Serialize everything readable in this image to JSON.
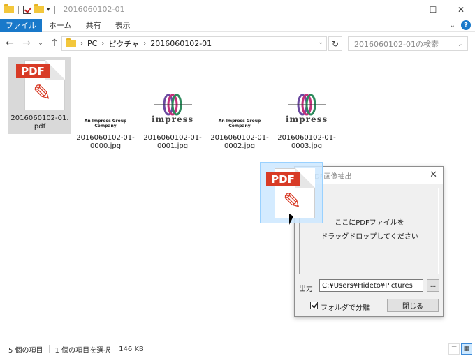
{
  "window": {
    "title": "2016060102-01",
    "min_glyph": "—",
    "max_glyph": "☐",
    "close_glyph": "✕"
  },
  "ribbon": {
    "tabs": [
      "ファイル",
      "ホーム",
      "共有",
      "表示"
    ],
    "collapse_glyph": "⌄",
    "help_glyph": "?"
  },
  "nav": {
    "back_glyph": "←",
    "forward_glyph": "→",
    "recent_glyph": "⌄",
    "up_glyph": "↑",
    "breadcrumb": [
      "PC",
      "ピクチャ",
      "2016060102-01"
    ],
    "crumb_sep": "›",
    "dropdown_glyph": "⌄",
    "refresh_glyph": "↻",
    "search_placeholder": "2016060102-01の検索",
    "search_glyph": "⌕"
  },
  "files": [
    {
      "name": "2016060102-01.pdf",
      "kind": "pdf",
      "badge": "PDF",
      "glyph": "✎"
    },
    {
      "name": "2016060102-01-0000.jpg",
      "kind": "impress-small",
      "logo": "An Impress Group Company"
    },
    {
      "name": "2016060102-01-0001.jpg",
      "kind": "impress-big",
      "logo": "impress"
    },
    {
      "name": "2016060102-01-0002.jpg",
      "kind": "impress-small",
      "logo": "An Impress Group Company"
    },
    {
      "name": "2016060102-01-0003.jpg",
      "kind": "impress-big",
      "logo": "impress"
    }
  ],
  "dialog": {
    "title": "PDF画像抽出",
    "close_glyph": "✕",
    "drop_line1": "ここにPDFファイルを",
    "drop_line2": "ドラッグドロップしてください",
    "output_label": "出力",
    "output_value": "C:¥Users¥Hideto¥Pictures",
    "browse_label": "...",
    "checkbox_label": "フォルダで分離",
    "checkbox_checked": true,
    "close_label": "閉じる"
  },
  "drag_ghost": {
    "badge": "PDF",
    "glyph": "✎"
  },
  "status": {
    "item_count": "5 個の項目",
    "selection": "1 個の項目を選択",
    "size": "146 KB",
    "details_view_glyph": "☰",
    "large_icons_glyph": "▦"
  },
  "colors": {
    "accent": "#1979ca",
    "pdf_red": "#d83b26",
    "selection": "#cce8ff"
  }
}
